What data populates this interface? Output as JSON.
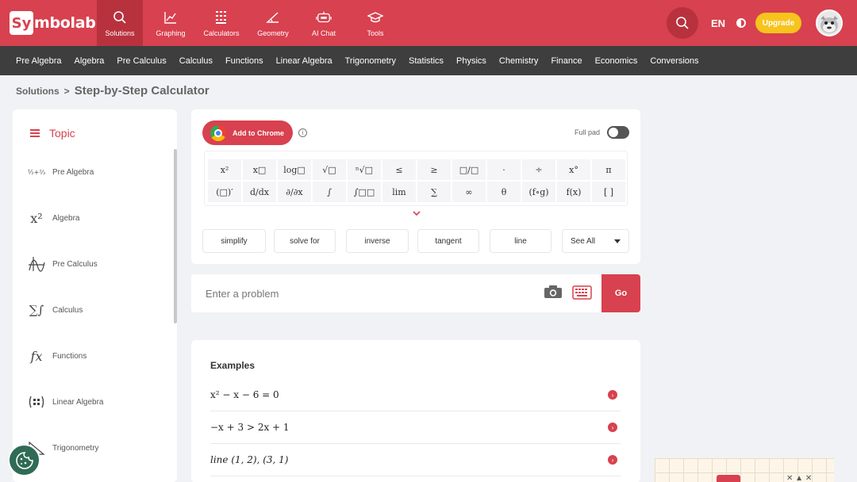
{
  "brand": {
    "logo_box": "Sy",
    "logo_text": "mbolab"
  },
  "nav": {
    "tabs": [
      {
        "label": "Solutions"
      },
      {
        "label": "Graphing"
      },
      {
        "label": "Calculators"
      },
      {
        "label": "Geometry"
      },
      {
        "label": "AI Chat"
      },
      {
        "label": "Tools"
      }
    ],
    "lang": "EN",
    "upgrade": "Upgrade"
  },
  "subnav": [
    "Pre Algebra",
    "Algebra",
    "Pre Calculus",
    "Calculus",
    "Functions",
    "Linear Algebra",
    "Trigonometry",
    "Statistics",
    "Physics",
    "Chemistry",
    "Finance",
    "Economics",
    "Conversions"
  ],
  "breadcrumb": {
    "root": "Solutions",
    "sep": ">",
    "current": "Step-by-Step Calculator"
  },
  "sidebar": {
    "topic": "Topic",
    "items": [
      {
        "label": "Pre Algebra",
        "icon": "fraction-add-icon"
      },
      {
        "label": "Algebra",
        "icon": "x-squared-icon"
      },
      {
        "label": "Pre Calculus",
        "icon": "curve-icon"
      },
      {
        "label": "Calculus",
        "icon": "sum-integral-icon"
      },
      {
        "label": "Functions",
        "icon": "fx-icon"
      },
      {
        "label": "Linear Algebra",
        "icon": "matrix-icon"
      },
      {
        "label": "Trigonometry",
        "icon": "triangle-icon"
      }
    ]
  },
  "panel": {
    "add_to_chrome": "Add to Chrome",
    "info": "i",
    "full_pad": "Full pad",
    "keys_row1": [
      "x²",
      "x□",
      "log□",
      "√□",
      "ⁿ√□",
      "≤",
      "≥",
      "□/□",
      "·",
      "÷",
      "x°",
      "π"
    ],
    "keys_row2": [
      "(□)′",
      "d/dx",
      "∂/∂x",
      "∫",
      "∫□□",
      "lim",
      "∑",
      "∞",
      "θ",
      "(f∘g)",
      "f(x)",
      "[ ]"
    ],
    "quick": [
      "simplify",
      "solve for",
      "inverse",
      "tangent",
      "line"
    ],
    "see_all": "See All"
  },
  "input": {
    "placeholder": "Enter a problem",
    "value": "",
    "go": "Go"
  },
  "examples": {
    "title": "Examples",
    "items": [
      "x² − x − 6 = 0",
      "−x + 3 > 2x + 1",
      "line (1, 2), (3, 1)"
    ]
  }
}
